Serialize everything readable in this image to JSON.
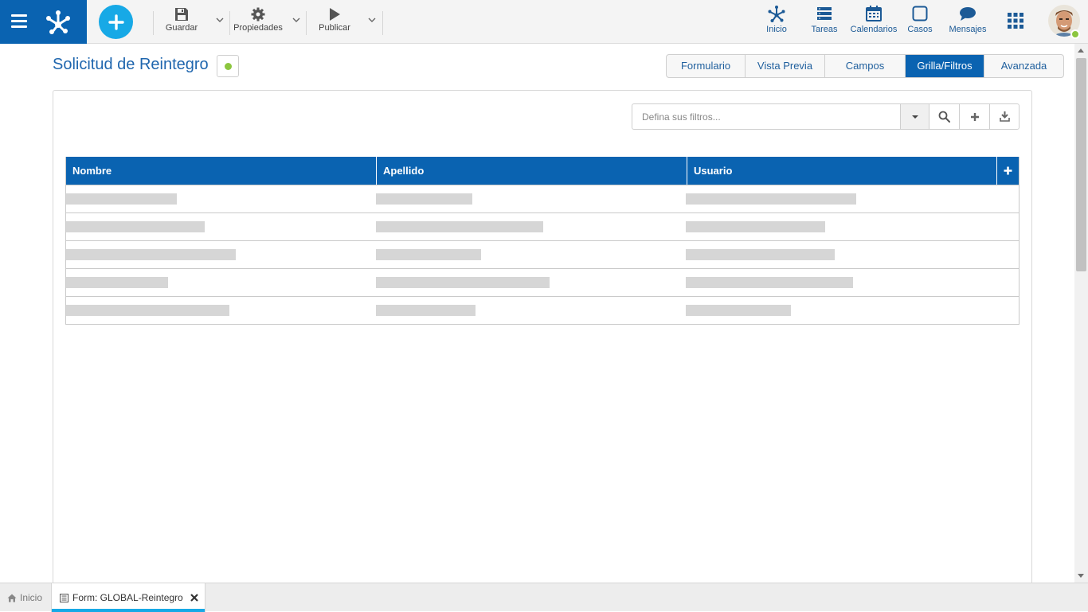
{
  "toolbar": {
    "guardar": "Guardar",
    "propiedades": "Propiedades",
    "publicar": "Publicar"
  },
  "nav": {
    "inicio": "Inicio",
    "tareas": "Tareas",
    "calendarios": "Calendarios",
    "casos": "Casos",
    "mensajes": "Mensajes"
  },
  "page": {
    "title": "Solicitud de Reintegro",
    "tabs": [
      "Formulario",
      "Vista Previa",
      "Campos",
      "Grilla/Filtros",
      "Avanzada"
    ],
    "active_tab": "Grilla/Filtros"
  },
  "filter": {
    "placeholder": "Defina sus filtros..."
  },
  "grid": {
    "columns": [
      "Nombre",
      "Apellido",
      "Usuario"
    ],
    "rows": 5
  },
  "bottom_tabs": {
    "home": "Inicio",
    "form": "Form: GLOBAL-Reintegro"
  },
  "colors": {
    "primary": "#0a63b1",
    "accent": "#17a9e6",
    "status": "#8cc63f"
  }
}
